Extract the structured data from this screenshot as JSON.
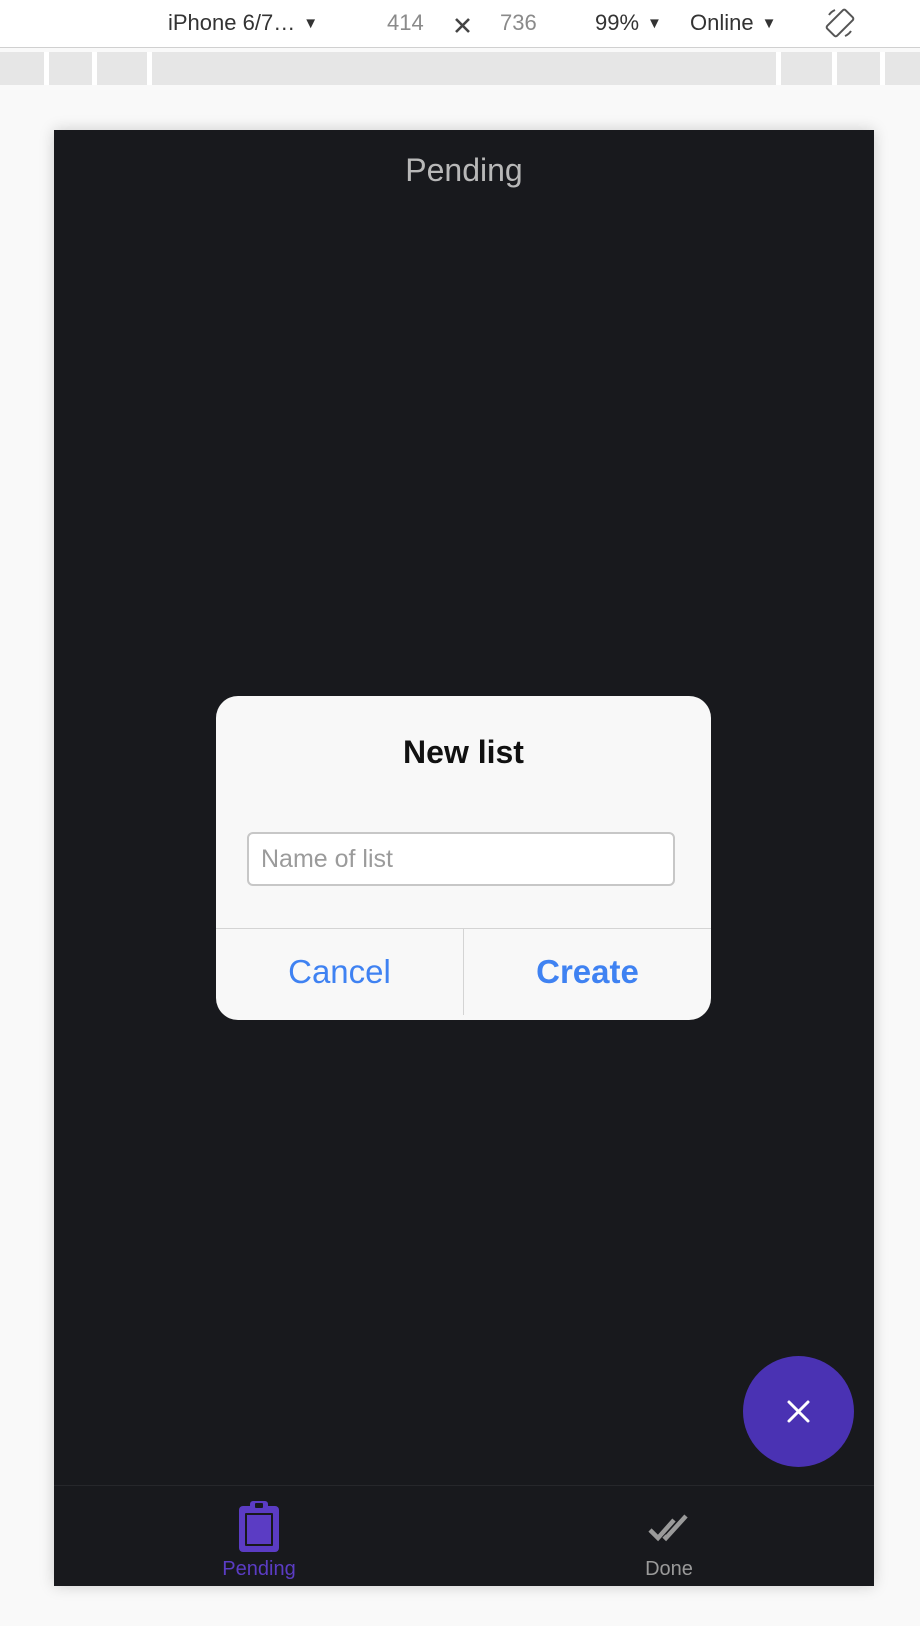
{
  "devtools": {
    "device": "iPhone 6/7…",
    "width": "414",
    "height": "736",
    "zoom": "99%",
    "network": "Online",
    "caret": "▼"
  },
  "app": {
    "title": "Pending"
  },
  "dialog": {
    "title": "New list",
    "input_placeholder": "Name of list",
    "input_value": "",
    "cancel_label": "Cancel",
    "create_label": "Create"
  },
  "tabs": [
    {
      "label": "Pending",
      "icon": "clipboard-icon",
      "active": true,
      "color": "#5b3cc4"
    },
    {
      "label": "Done",
      "icon": "double-check-icon",
      "active": false,
      "color": "#9a9a9a"
    }
  ],
  "fab": {
    "icon": "close-icon",
    "color": "#4a32b3"
  },
  "colors": {
    "background": "#18191d",
    "accent": "#4a32b3",
    "link": "#3f82f2"
  }
}
